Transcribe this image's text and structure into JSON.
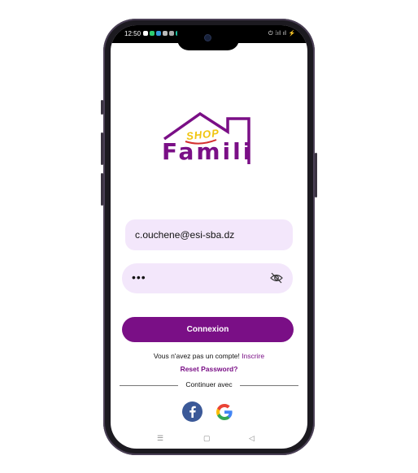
{
  "status": {
    "time": "12:50",
    "right_icons": "⏻ ⁞ıl ıl ⚡"
  },
  "logo": {
    "shop": "SHOP",
    "brand": "Famili"
  },
  "form": {
    "email_value": "c.ouchene@esi-sba.dz",
    "password_value": "•••",
    "connect_label": "Connexion"
  },
  "links": {
    "no_account": "Vous n'avez pas un compte!",
    "signup": "Inscrire",
    "reset": "Reset Password?",
    "continue_with": "Continuer avec"
  },
  "nav": {
    "menu": "☰",
    "home": "▢",
    "back": "◁"
  },
  "colors": {
    "brand": "#7a0f86",
    "field_bg": "#f3e7fb",
    "accent": "#f1c40f"
  },
  "icons": [
    "eye-off-icon",
    "facebook-icon",
    "google-icon"
  ]
}
